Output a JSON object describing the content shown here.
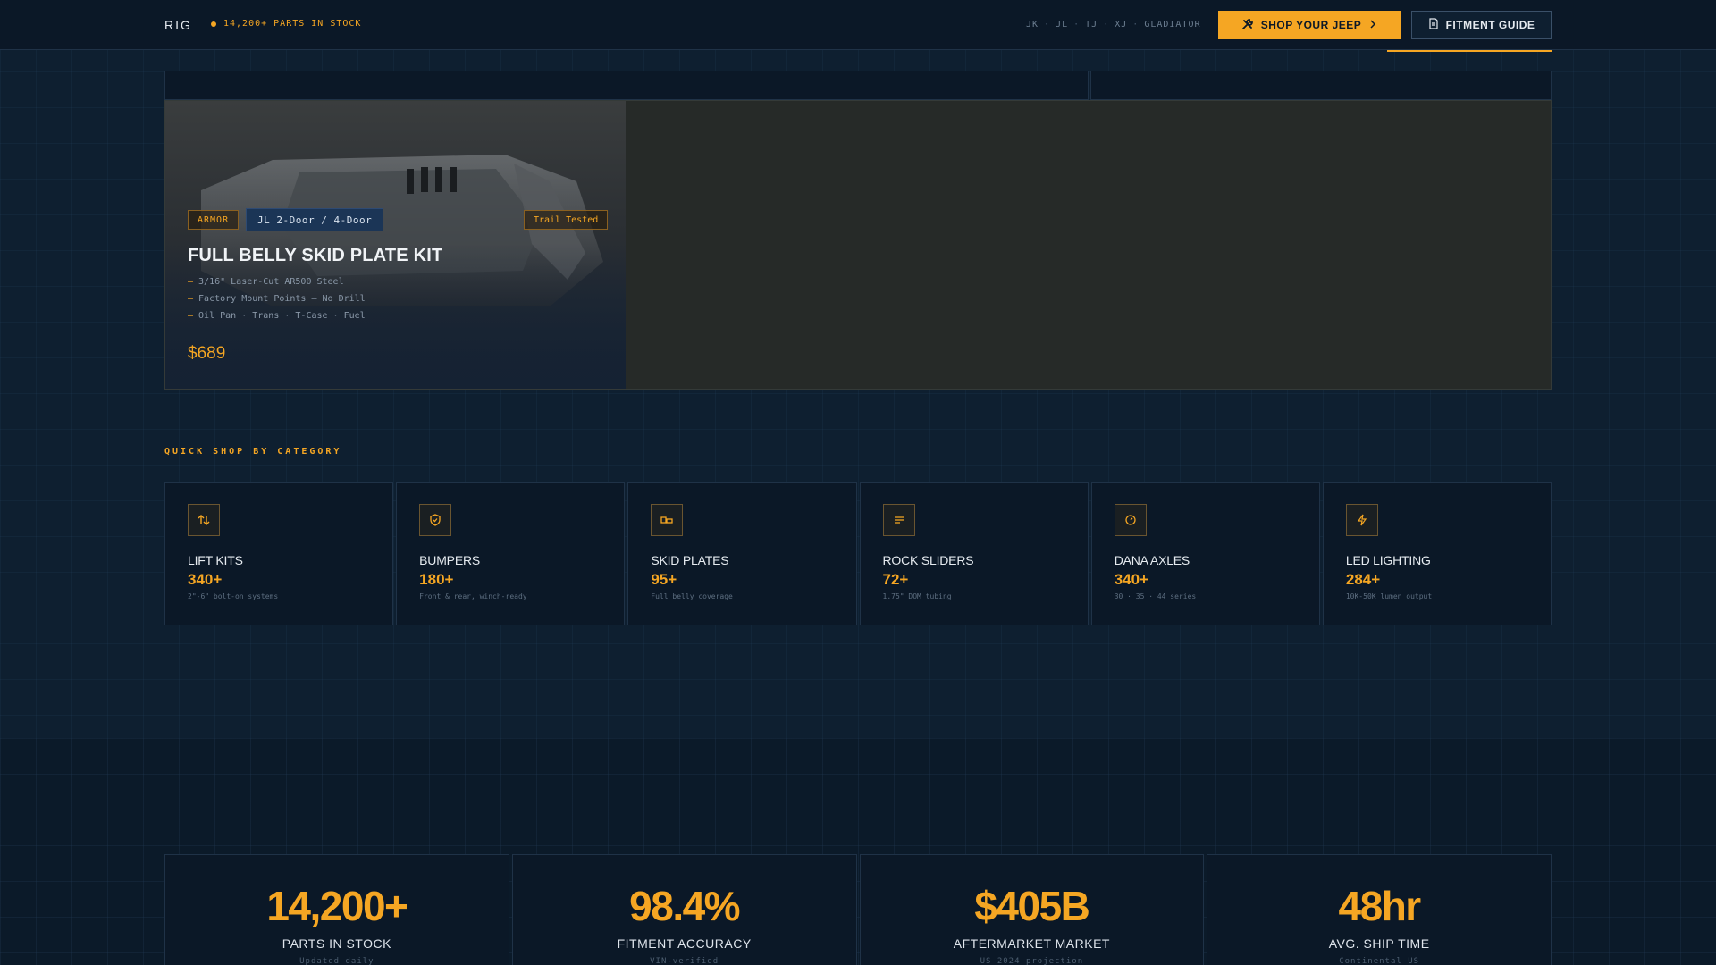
{
  "header": {
    "brand": "RIG",
    "stock_status": "14,200+ PARTS IN STOCK",
    "models": [
      "JK",
      "JL",
      "TJ",
      "XJ",
      "GLADIATOR"
    ],
    "separator": "·",
    "shop_button": "SHOP YOUR JEEP",
    "fitment_button": "FITMENT GUIDE"
  },
  "feature": {
    "tags": {
      "category": "ARMOR",
      "fitment": "JL 2-Door / 4-Door",
      "badge": "Trail Tested"
    },
    "title": "FULL BELLY SKID PLATE KIT",
    "specs": [
      "3/16\" Laser-Cut AR500 Steel",
      "Factory Mount Points — No Drill",
      "Oil Pan · Trans · T-Case · Fuel"
    ],
    "price": "$689"
  },
  "quick_shop": {
    "label": "QUICK SHOP BY CATEGORY",
    "categories": [
      {
        "name": "LIFT KITS",
        "count": "340+",
        "desc": "2\"-6\" bolt-on systems",
        "icon": "lift-arrows-icon"
      },
      {
        "name": "BUMPERS",
        "count": "180+",
        "desc": "Front & rear, winch-ready",
        "icon": "shield-icon"
      },
      {
        "name": "SKID PLATES",
        "count": "95+",
        "desc": "Full belly coverage",
        "icon": "plates-icon"
      },
      {
        "name": "ROCK SLIDERS",
        "count": "72+",
        "desc": "1.75\" DOM tubing",
        "icon": "lines-icon"
      },
      {
        "name": "DANA AXLES",
        "count": "340+",
        "desc": "30 · 35 · 44 series",
        "icon": "gear-icon"
      },
      {
        "name": "LED LIGHTING",
        "count": "284+",
        "desc": "10K-50K lumen output",
        "icon": "bolt-icon"
      }
    ]
  },
  "stats": [
    {
      "value": "14,200+",
      "label": "PARTS IN STOCK",
      "sub": "Updated daily"
    },
    {
      "value": "98.4%",
      "label": "FITMENT ACCURACY",
      "sub": "VIN-verified"
    },
    {
      "value": "$405B",
      "label": "AFTERMARKET MARKET",
      "sub": "US 2024 projection"
    },
    {
      "value": "48hr",
      "label": "AVG. SHIP TIME",
      "sub": "Continental US"
    }
  ],
  "colors": {
    "accent": "#f5a623",
    "background": "#0d1b2a",
    "card": "#0b1827",
    "fitment_tag": "#1b3556"
  }
}
